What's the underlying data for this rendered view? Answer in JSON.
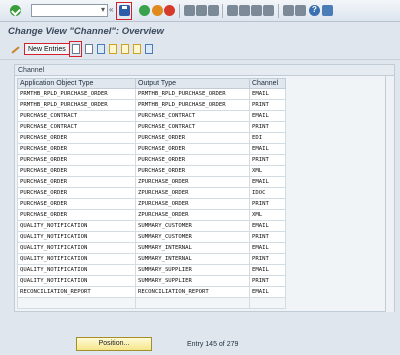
{
  "toolbar": {
    "command_field_value": "",
    "icons": [
      "check-icon",
      "save-icon",
      "back-icon",
      "exit-icon",
      "cancel-icon",
      "print-icon",
      "find-icon",
      "find-next-icon",
      "first-page-icon",
      "prev-page-icon",
      "next-page-icon",
      "last-page-icon",
      "new-session-icon",
      "shortcut-icon",
      "help-icon",
      "customize-icon"
    ]
  },
  "title": "Change View \"Channel\": Overview",
  "app_toolbar": {
    "new_entries_label": "New Entries",
    "icons": [
      "pen-icon",
      "copy-as-icon",
      "delete-icon",
      "undo-icon",
      "select-all-icon",
      "select-block-icon",
      "deselect-all-icon",
      "print-icon"
    ]
  },
  "panel": {
    "title": "Channel",
    "columns": [
      "Application Object Type",
      "Output Type",
      "Channel"
    ],
    "rows": [
      [
        "PRMTHB_RPLD_PURCHASE_ORDER",
        "PRMTHB_RPLD_PURCHASE_ORDER",
        "EMAIL"
      ],
      [
        "PRMTHB_RPLD_PURCHASE_ORDER",
        "PRMTHB_RPLD_PURCHASE_ORDER",
        "PRINT"
      ],
      [
        "PURCHASE_CONTRACT",
        "PURCHASE_CONTRACT",
        "EMAIL"
      ],
      [
        "PURCHASE_CONTRACT",
        "PURCHASE_CONTRACT",
        "PRINT"
      ],
      [
        "PURCHASE_ORDER",
        "PURCHASE_ORDER",
        "EDI"
      ],
      [
        "PURCHASE_ORDER",
        "PURCHASE_ORDER",
        "EMAIL"
      ],
      [
        "PURCHASE_ORDER",
        "PURCHASE_ORDER",
        "PRINT"
      ],
      [
        "PURCHASE_ORDER",
        "PURCHASE_ORDER",
        "XML"
      ],
      [
        "PURCHASE_ORDER",
        "ZPURCHASE_ORDER",
        "EMAIL"
      ],
      [
        "PURCHASE_ORDER",
        "ZPURCHASE_ORDER",
        "IDOC"
      ],
      [
        "PURCHASE_ORDER",
        "ZPURCHASE_ORDER",
        "PRINT"
      ],
      [
        "PURCHASE_ORDER",
        "ZPURCHASE_ORDER",
        "XML"
      ],
      [
        "QUALITY_NOTIFICATION",
        "SUMMARY_CUSTOMER",
        "EMAIL"
      ],
      [
        "QUALITY_NOTIFICATION",
        "SUMMARY_CUSTOMER",
        "PRINT"
      ],
      [
        "QUALITY_NOTIFICATION",
        "SUMMARY_INTERNAL",
        "EMAIL"
      ],
      [
        "QUALITY_NOTIFICATION",
        "SUMMARY_INTERNAL",
        "PRINT"
      ],
      [
        "QUALITY_NOTIFICATION",
        "SUMMARY_SUPPLIER",
        "EMAIL"
      ],
      [
        "QUALITY_NOTIFICATION",
        "SUMMARY_SUPPLIER",
        "PRINT"
      ],
      [
        "RECONCILIATION_REPORT",
        "RECONCILIATION_REPORT",
        "EMAIL"
      ]
    ],
    "empty_rows": 1
  },
  "footer": {
    "position_label": "Position...",
    "entry_text": "Entry 145 of 279"
  }
}
